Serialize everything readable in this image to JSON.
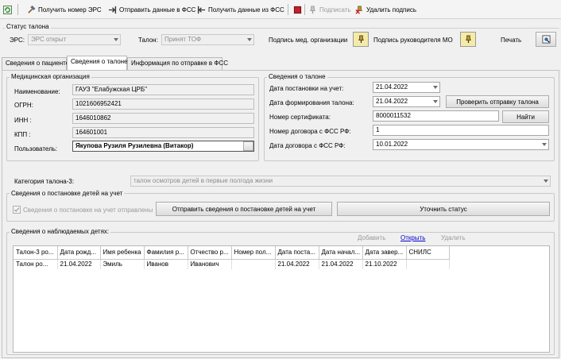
{
  "toolbar": {
    "get_ers": "Получить номер ЭРС",
    "send_fss": "Отправить данные в ФСС",
    "get_fss": "Получить данные из ФСС",
    "sign": "Подписать",
    "delete_sign": "Удалить подпись",
    "icons": [
      "refresh-icon",
      "hammer-icon",
      "send-icon",
      "receive-icon",
      "stop-icon",
      "sign-icon",
      "delete-sign-icon"
    ]
  },
  "status_group": {
    "title": "Статус талона",
    "ers_label": "ЭРС:",
    "ers_value": "ЭРС открыт",
    "talon_label": "Талон:",
    "talon_value": "Принят ТОФ",
    "sign_org_label": "Подпись мед. организации",
    "sign_head_label": "Подпись руководителя МО",
    "print_label": "Печать"
  },
  "tabs": [
    "Сведения о пациенте",
    "Сведения о талоне",
    "Информация по отправке в ФСС"
  ],
  "med_org": {
    "title": "Медицинская организация",
    "name_label": "Наименование:",
    "name_value": "ГАУЗ \"Елабужская ЦРБ\"",
    "ogrn_label": "ОГРН:",
    "ogrn_value": "1021606952421",
    "inn_label": "ИНН :",
    "inn_value": "1646010862",
    "kpp_label": "КПП :",
    "kpp_value": "164601001",
    "user_label": "Пользователь:",
    "user_value": "Якупова Рузиля Рузилевна (Витакор)"
  },
  "talon_info": {
    "title": "Сведения о талоне",
    "reg_date_label": "Дата постановки на учет:",
    "reg_date_value": "21.04.2022",
    "form_date_label": "Дата формирования талона:",
    "form_date_value": "21.04.2022",
    "check_button": "Проверить отправку талона",
    "cert_label": "Номер сертификата:",
    "cert_value": "8000011532",
    "find_button": "Найти",
    "contract_label": "Номер договора с ФСС РФ:",
    "contract_value": "1",
    "contract_date_label": "Дата договора с ФСС РФ:",
    "contract_date_value": "10.01.2022"
  },
  "category": {
    "label": "Категория талона-3:",
    "value": "талон осмотров детей в первые полгода жизни"
  },
  "registration": {
    "title": "Сведения о постановке детей на учет",
    "checkbox_label": "Сведения о постановке на учет отправлены",
    "send_button": "Отправить сведения о постановке детей на учет",
    "status_button": "Уточнить статус"
  },
  "children": {
    "title": "Сведения о наблюдаемых детях:",
    "add": "Добавить",
    "open": "Открыть",
    "delete": "Удалить",
    "columns": [
      "Талон-3 ро...",
      "Дата рожд...",
      "Имя ребенка",
      "Фамилия р...",
      "Отчество р...",
      "Номер пол...",
      "Дата поста...",
      "Дата начал...",
      "Дата завер...",
      "СНИЛС"
    ],
    "rows": [
      [
        "Талон ро...",
        "21.04.2022",
        "Эмиль",
        "Иванов",
        "Иванович",
        "",
        "21.04.2022",
        "21.04.2022",
        "21.10.2022",
        ""
      ]
    ]
  },
  "colors": {
    "link": "#0000cc",
    "disabled": "#9a9a9a",
    "sign_button": "#f4eba8"
  }
}
